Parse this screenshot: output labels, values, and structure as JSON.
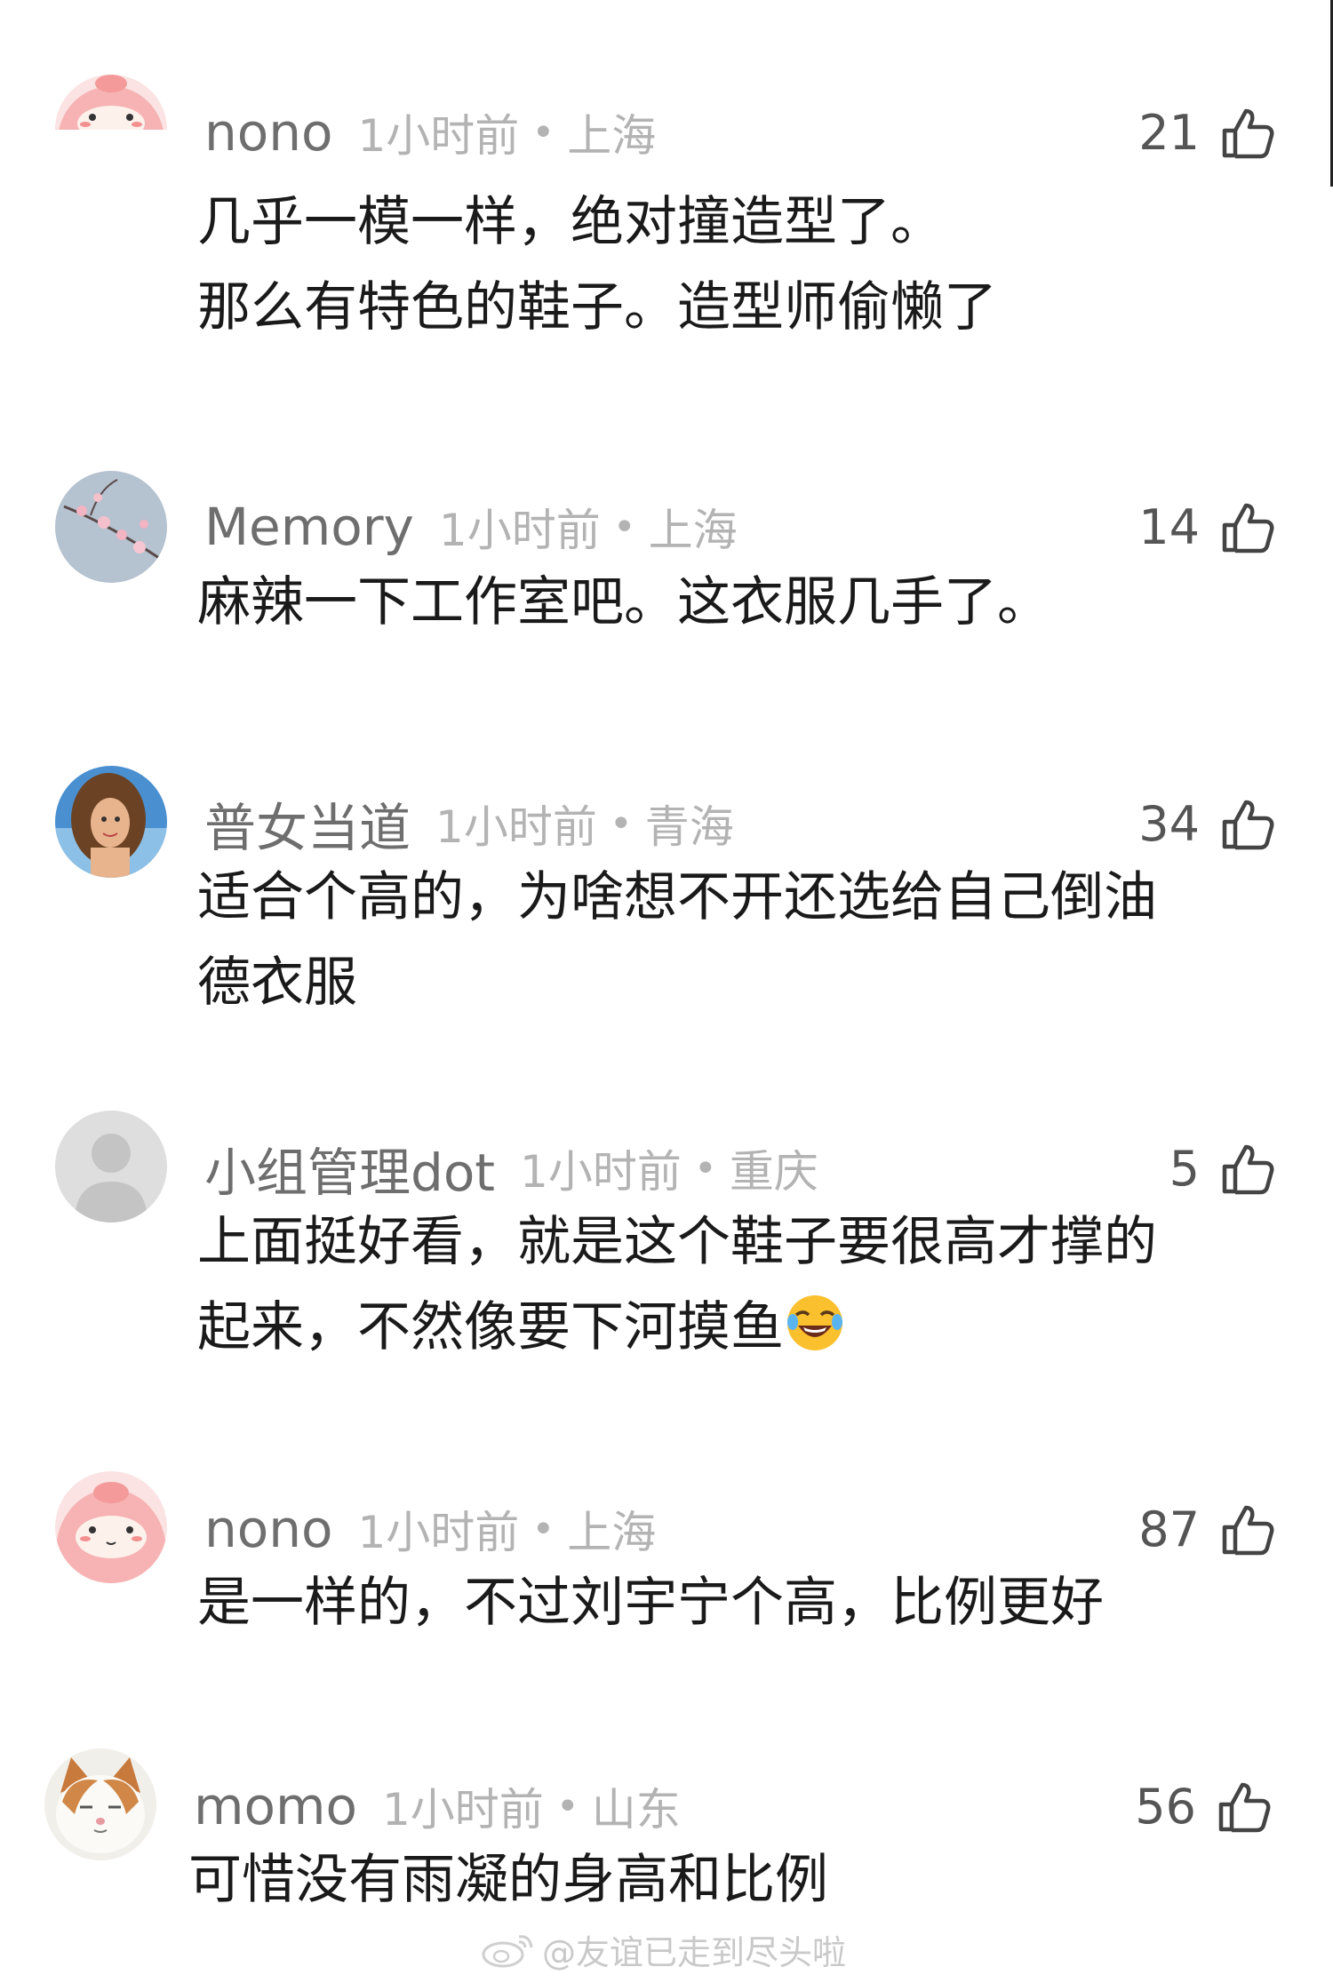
{
  "comments": [
    {
      "username": "nono",
      "time": "1小时前",
      "location": "上海",
      "likes": "21",
      "lines": [
        "几乎一模一样，绝对撞造型了。",
        "那么有特色的鞋子。造型师偷懒了"
      ],
      "avatar": "pink-blob-avatar"
    },
    {
      "username": "Memory",
      "time": "1小时前",
      "location": "上海",
      "likes": "14",
      "lines": [
        "麻辣一下工作室吧。这衣服几手了。"
      ],
      "avatar": "cherry-blossom-avatar"
    },
    {
      "username": "普女当道",
      "time": "1小时前",
      "location": "青海",
      "likes": "34",
      "lines": [
        "适合个高的，为啥想不开还选给自己倒油",
        "德衣服"
      ],
      "avatar": "woman-portrait-avatar"
    },
    {
      "username": "小组管理dot",
      "time": "1小时前",
      "location": "重庆",
      "likes": "5",
      "lines": [
        "上面挺好看，就是这个鞋子要很高才撑的",
        "起来，不然像要下河摸鱼"
      ],
      "avatar": "default-gray-avatar",
      "emoji": "laughing-tears-emoji"
    },
    {
      "username": "nono",
      "time": "1小时前",
      "location": "上海",
      "likes": "87",
      "lines": [
        "是一样的，不过刘宇宁个高，比例更好"
      ],
      "avatar": "pink-blob-avatar"
    },
    {
      "username": "momo",
      "time": "1小时前",
      "location": "山东",
      "likes": "56",
      "lines": [
        "可惜没有雨凝的身高和比例"
      ],
      "avatar": "cat-avatar"
    }
  ],
  "separator_dot": "•",
  "watermark": {
    "text": "@友谊已走到尽头啦",
    "icon": "weibo-logo-icon"
  },
  "colors": {
    "username": "#6e6e6e",
    "meta": "#b3b3b3",
    "body": "#1a1a1a",
    "watermark": "#c9c9c9"
  }
}
